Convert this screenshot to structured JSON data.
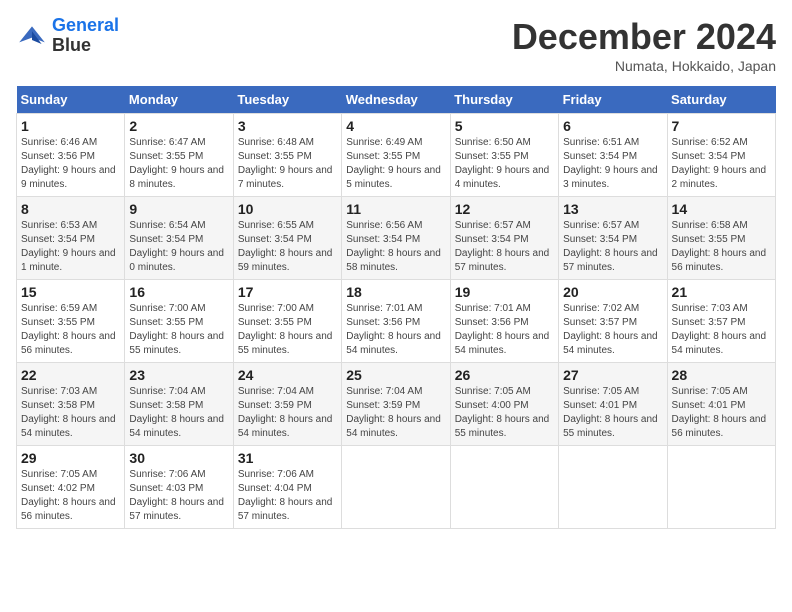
{
  "logo": {
    "line1": "General",
    "line2": "Blue"
  },
  "title": "December 2024",
  "location": "Numata, Hokkaido, Japan",
  "weekdays": [
    "Sunday",
    "Monday",
    "Tuesday",
    "Wednesday",
    "Thursday",
    "Friday",
    "Saturday"
  ],
  "weeks": [
    [
      {
        "day": "1",
        "sunrise": "6:46 AM",
        "sunset": "3:56 PM",
        "daylight": "9 hours and 9 minutes."
      },
      {
        "day": "2",
        "sunrise": "6:47 AM",
        "sunset": "3:55 PM",
        "daylight": "9 hours and 8 minutes."
      },
      {
        "day": "3",
        "sunrise": "6:48 AM",
        "sunset": "3:55 PM",
        "daylight": "9 hours and 7 minutes."
      },
      {
        "day": "4",
        "sunrise": "6:49 AM",
        "sunset": "3:55 PM",
        "daylight": "9 hours and 5 minutes."
      },
      {
        "day": "5",
        "sunrise": "6:50 AM",
        "sunset": "3:55 PM",
        "daylight": "9 hours and 4 minutes."
      },
      {
        "day": "6",
        "sunrise": "6:51 AM",
        "sunset": "3:54 PM",
        "daylight": "9 hours and 3 minutes."
      },
      {
        "day": "7",
        "sunrise": "6:52 AM",
        "sunset": "3:54 PM",
        "daylight": "9 hours and 2 minutes."
      }
    ],
    [
      {
        "day": "8",
        "sunrise": "6:53 AM",
        "sunset": "3:54 PM",
        "daylight": "9 hours and 1 minute."
      },
      {
        "day": "9",
        "sunrise": "6:54 AM",
        "sunset": "3:54 PM",
        "daylight": "9 hours and 0 minutes."
      },
      {
        "day": "10",
        "sunrise": "6:55 AM",
        "sunset": "3:54 PM",
        "daylight": "8 hours and 59 minutes."
      },
      {
        "day": "11",
        "sunrise": "6:56 AM",
        "sunset": "3:54 PM",
        "daylight": "8 hours and 58 minutes."
      },
      {
        "day": "12",
        "sunrise": "6:57 AM",
        "sunset": "3:54 PM",
        "daylight": "8 hours and 57 minutes."
      },
      {
        "day": "13",
        "sunrise": "6:57 AM",
        "sunset": "3:54 PM",
        "daylight": "8 hours and 57 minutes."
      },
      {
        "day": "14",
        "sunrise": "6:58 AM",
        "sunset": "3:55 PM",
        "daylight": "8 hours and 56 minutes."
      }
    ],
    [
      {
        "day": "15",
        "sunrise": "6:59 AM",
        "sunset": "3:55 PM",
        "daylight": "8 hours and 56 minutes."
      },
      {
        "day": "16",
        "sunrise": "7:00 AM",
        "sunset": "3:55 PM",
        "daylight": "8 hours and 55 minutes."
      },
      {
        "day": "17",
        "sunrise": "7:00 AM",
        "sunset": "3:55 PM",
        "daylight": "8 hours and 55 minutes."
      },
      {
        "day": "18",
        "sunrise": "7:01 AM",
        "sunset": "3:56 PM",
        "daylight": "8 hours and 54 minutes."
      },
      {
        "day": "19",
        "sunrise": "7:01 AM",
        "sunset": "3:56 PM",
        "daylight": "8 hours and 54 minutes."
      },
      {
        "day": "20",
        "sunrise": "7:02 AM",
        "sunset": "3:57 PM",
        "daylight": "8 hours and 54 minutes."
      },
      {
        "day": "21",
        "sunrise": "7:03 AM",
        "sunset": "3:57 PM",
        "daylight": "8 hours and 54 minutes."
      }
    ],
    [
      {
        "day": "22",
        "sunrise": "7:03 AM",
        "sunset": "3:58 PM",
        "daylight": "8 hours and 54 minutes."
      },
      {
        "day": "23",
        "sunrise": "7:04 AM",
        "sunset": "3:58 PM",
        "daylight": "8 hours and 54 minutes."
      },
      {
        "day": "24",
        "sunrise": "7:04 AM",
        "sunset": "3:59 PM",
        "daylight": "8 hours and 54 minutes."
      },
      {
        "day": "25",
        "sunrise": "7:04 AM",
        "sunset": "3:59 PM",
        "daylight": "8 hours and 54 minutes."
      },
      {
        "day": "26",
        "sunrise": "7:05 AM",
        "sunset": "4:00 PM",
        "daylight": "8 hours and 55 minutes."
      },
      {
        "day": "27",
        "sunrise": "7:05 AM",
        "sunset": "4:01 PM",
        "daylight": "8 hours and 55 minutes."
      },
      {
        "day": "28",
        "sunrise": "7:05 AM",
        "sunset": "4:01 PM",
        "daylight": "8 hours and 56 minutes."
      }
    ],
    [
      {
        "day": "29",
        "sunrise": "7:05 AM",
        "sunset": "4:02 PM",
        "daylight": "8 hours and 56 minutes."
      },
      {
        "day": "30",
        "sunrise": "7:06 AM",
        "sunset": "4:03 PM",
        "daylight": "8 hours and 57 minutes."
      },
      {
        "day": "31",
        "sunrise": "7:06 AM",
        "sunset": "4:04 PM",
        "daylight": "8 hours and 57 minutes."
      },
      null,
      null,
      null,
      null
    ]
  ]
}
